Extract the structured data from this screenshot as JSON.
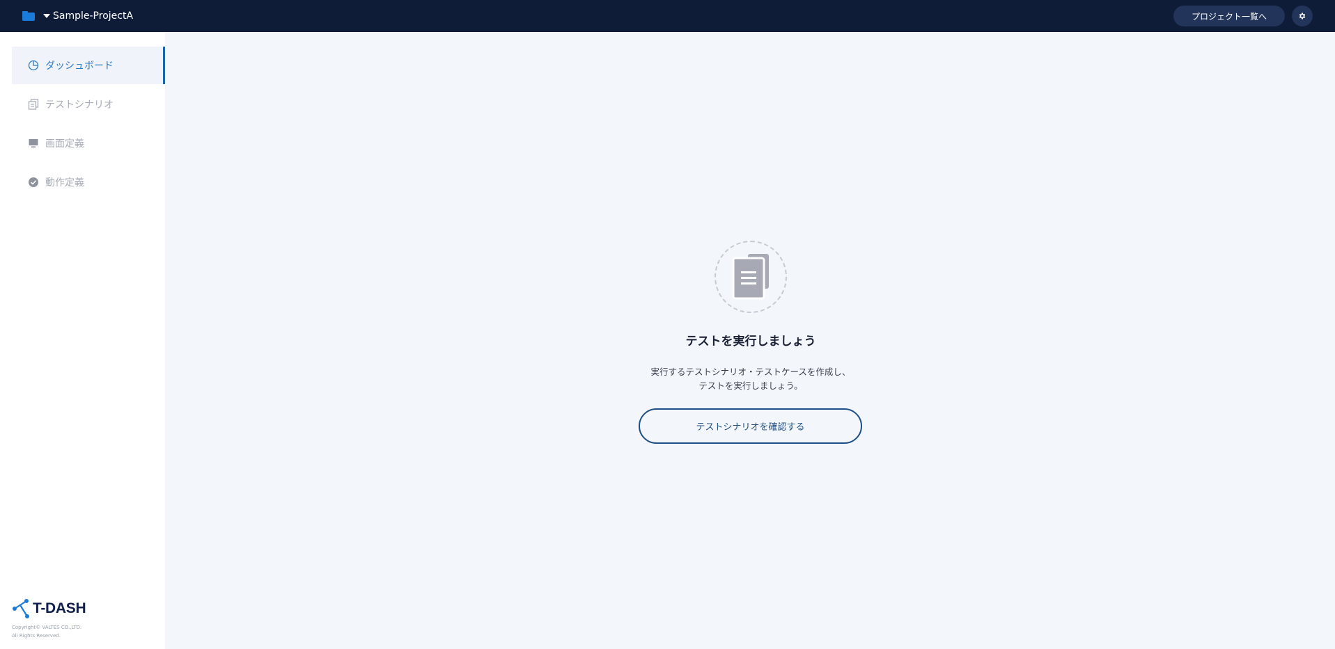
{
  "header": {
    "project_name": "Sample-ProjectA",
    "projects_button_label": "プロジェクト一覧へ"
  },
  "sidebar": {
    "items": [
      {
        "label": "ダッシュボード",
        "icon": "pie-chart-icon",
        "active": true
      },
      {
        "label": "テストシナリオ",
        "icon": "documents-icon",
        "active": false
      },
      {
        "label": "画面定義",
        "icon": "monitor-icon",
        "active": false
      },
      {
        "label": "動作定義",
        "icon": "check-circle-icon",
        "active": false
      }
    ],
    "logo_text": "T-DASH",
    "copyright_line1": "Copyright© VALTES CO.,LTD.",
    "copyright_line2": "All Rights Reserved."
  },
  "main": {
    "empty_icon": "document-stack-icon",
    "title": "テストを実行しましょう",
    "desc_line1": "実行するテストシナリオ・テストケースを作成し、",
    "desc_line2": "テストを実行しましょう。",
    "cta_label": "テストシナリオを確認する"
  },
  "colors": {
    "topbar": "#0f1c38",
    "accent": "#1d63b0",
    "active_text": "#2f7bc2",
    "background": "#f3f6fb"
  }
}
